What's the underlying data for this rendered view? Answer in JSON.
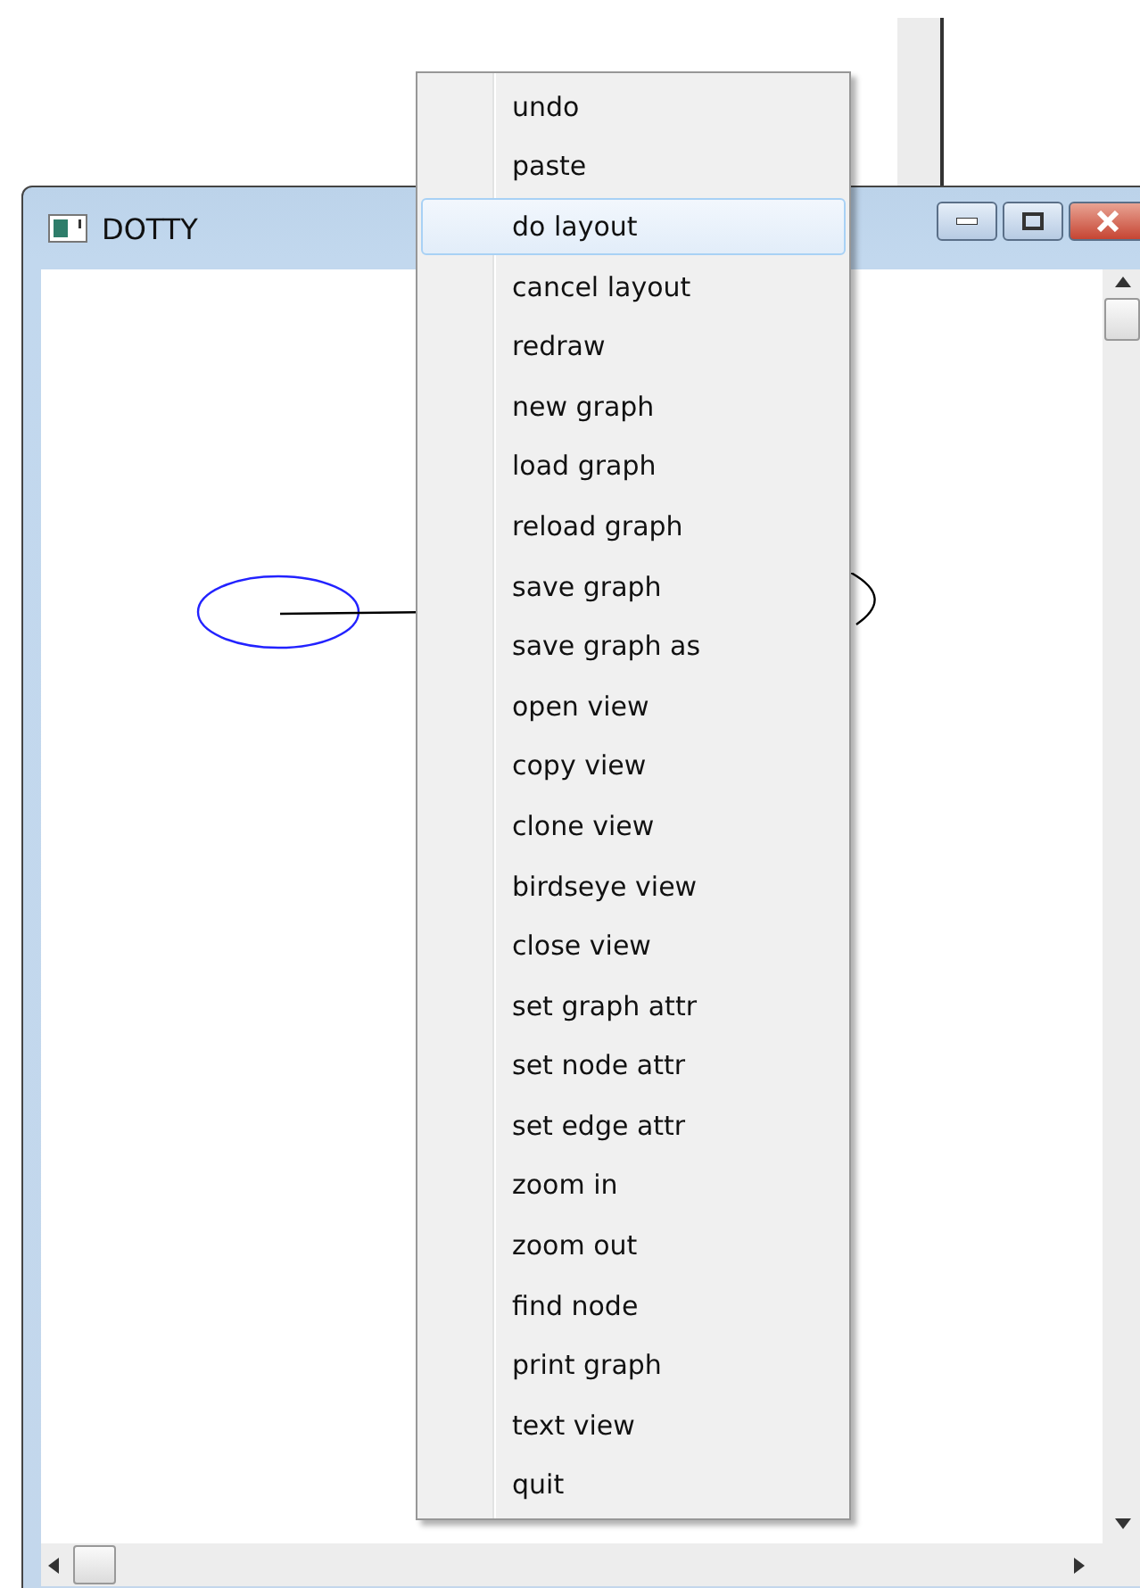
{
  "window": {
    "title": "DOTTY"
  },
  "menu": {
    "items": [
      {
        "label": "undo",
        "selected": false
      },
      {
        "label": "paste",
        "selected": false
      },
      {
        "label": "do layout",
        "selected": true
      },
      {
        "label": "cancel layout",
        "selected": false
      },
      {
        "label": "redraw",
        "selected": false
      },
      {
        "label": "new graph",
        "selected": false
      },
      {
        "label": "load graph",
        "selected": false
      },
      {
        "label": "reload graph",
        "selected": false
      },
      {
        "label": "save graph",
        "selected": false
      },
      {
        "label": "save graph as",
        "selected": false
      },
      {
        "label": "open view",
        "selected": false
      },
      {
        "label": "copy view",
        "selected": false
      },
      {
        "label": "clone view",
        "selected": false
      },
      {
        "label": "birdseye view",
        "selected": false
      },
      {
        "label": "close view",
        "selected": false
      },
      {
        "label": "set graph attr",
        "selected": false
      },
      {
        "label": "set node attr",
        "selected": false
      },
      {
        "label": "set edge attr",
        "selected": false
      },
      {
        "label": "zoom in",
        "selected": false
      },
      {
        "label": "zoom out",
        "selected": false
      },
      {
        "label": "find node",
        "selected": false
      },
      {
        "label": "print graph",
        "selected": false
      },
      {
        "label": "text view",
        "selected": false
      },
      {
        "label": "quit",
        "selected": false
      }
    ]
  }
}
